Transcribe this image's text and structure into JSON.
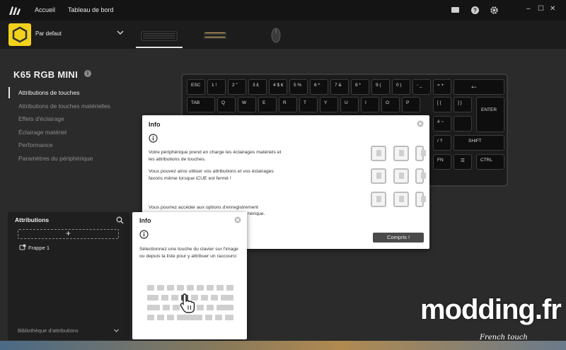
{
  "titlebar": {
    "nav": [
      "Accueil",
      "Tableau de bord"
    ],
    "icons": [
      "message-icon",
      "help-icon",
      "gear-icon"
    ],
    "window_controls": [
      "–",
      "☐",
      "✕"
    ]
  },
  "profile": {
    "name": "Par defaut",
    "accent_color": "#f2d21b"
  },
  "device": {
    "title": "K65 RGB MINI"
  },
  "side_menu": [
    "Attributions de touches",
    "Attributions de touches matérielles",
    "Effets d'éclairage",
    "Éclairage matériel",
    "Performance",
    "Paramètres du périphérique"
  ],
  "keyboard": {
    "row1": [
      "ESC",
      "1 !",
      "2 \"",
      "3 £",
      "4 $ €",
      "5 %",
      "6 ^",
      "7 &",
      "8 *",
      "9 (",
      "0 )",
      "- _",
      "= +",
      "←"
    ],
    "row2": [
      "TAB",
      "Q",
      "W",
      "E",
      "R",
      "T",
      "Y",
      "U",
      "I",
      "O",
      "P",
      "[ {",
      "] }",
      "ENTER"
    ],
    "row3": [
      "# ~"
    ],
    "row4": [
      "/ ?",
      "SHIFT"
    ],
    "row5": [
      "FN",
      "☰",
      "CTRL"
    ]
  },
  "attributions": {
    "title": "Attributions",
    "add_symbol": "+",
    "items": [
      "Frappe 1"
    ],
    "library_label": "Bibliothèque d'attributions"
  },
  "dialog_main": {
    "title": "Info",
    "p1": "Votre périphérique prend en charge les éclairages matériels et les attributions de touches.",
    "p2": "Vous pouvez ainsi utiliser vos attributions et vos éclairages favoris même lorsque iCUE est fermé !",
    "p3": "Vous pourrez accéder aux options d'enregistrement",
    "p3b": "hérique.",
    "button": "Compris !"
  },
  "dialog_small": {
    "title": "Info",
    "text": "Sélectionnez une touche du clavier sur l'image ou depuis la liste pour y attribuer un raccourci"
  },
  "watermark": {
    "main": "modding.fr",
    "sub": "French touch"
  }
}
